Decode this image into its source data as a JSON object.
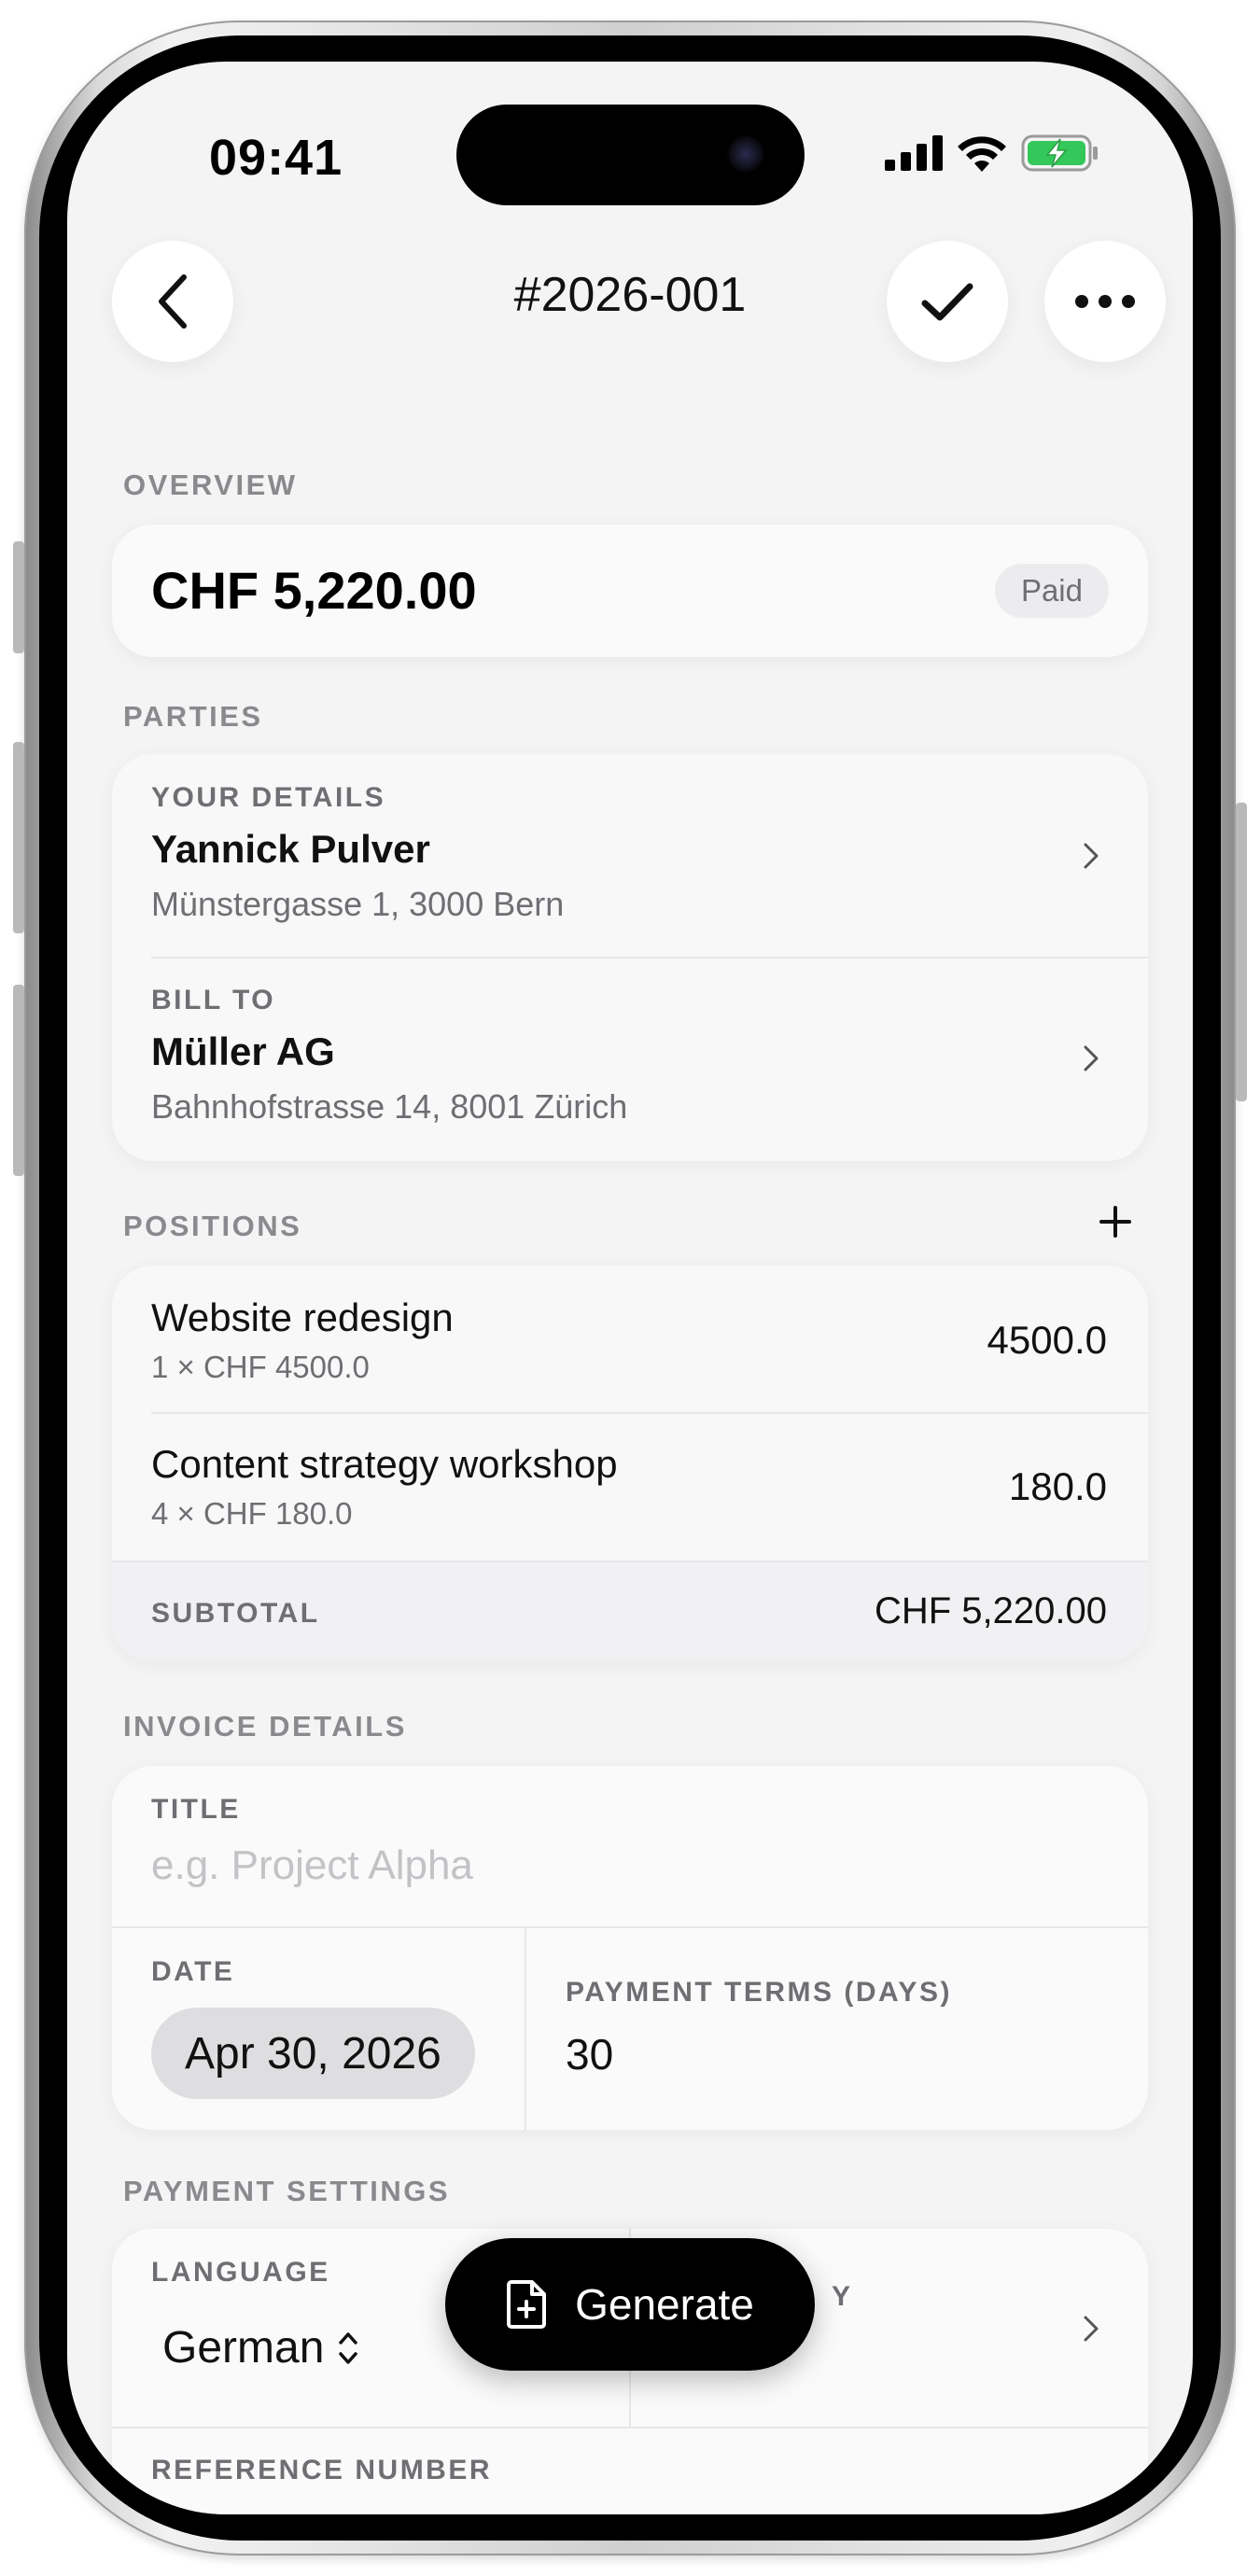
{
  "status_bar": {
    "time": "09:41"
  },
  "header": {
    "title": "#2026-001"
  },
  "overview": {
    "label": "OVERVIEW",
    "total": "CHF 5,220.00",
    "status_badge": "Paid"
  },
  "parties": {
    "label": "PARTIES",
    "sender": {
      "label": "YOUR DETAILS",
      "name": "Yannick Pulver",
      "address": "Münstergasse 1, 3000 Bern"
    },
    "recipient": {
      "label": "BILL TO",
      "name": "Müller AG",
      "address": "Bahnhofstrasse 14, 8001 Zürich"
    }
  },
  "positions": {
    "label": "POSITIONS",
    "items": [
      {
        "title": "Website redesign",
        "detail": "1 × CHF 4500.0",
        "amount": "4500.0"
      },
      {
        "title": "Content strategy workshop",
        "detail": "4 × CHF 180.0",
        "amount": "180.0"
      }
    ],
    "subtotal_label": "SUBTOTAL",
    "subtotal_value": "CHF 5,220.00"
  },
  "invoice_details": {
    "label": "INVOICE DETAILS",
    "title_label": "TITLE",
    "title_placeholder": "e.g. Project Alpha",
    "date_label": "DATE",
    "date_value": "Apr 30, 2026",
    "payment_terms_label": "PAYMENT TERMS (DAYS)",
    "payment_terms_value": "30"
  },
  "payment_settings": {
    "label": "PAYMENT SETTINGS",
    "language_label": "LANGUAGE",
    "language_value": "German",
    "currency_label_partial": "Y",
    "reference_label": "REFERENCE NUMBER"
  },
  "generate_button": {
    "label": "Generate"
  },
  "colors": {
    "accent": "#000000",
    "battery": "#34c759",
    "background": "#f4f4f5"
  }
}
